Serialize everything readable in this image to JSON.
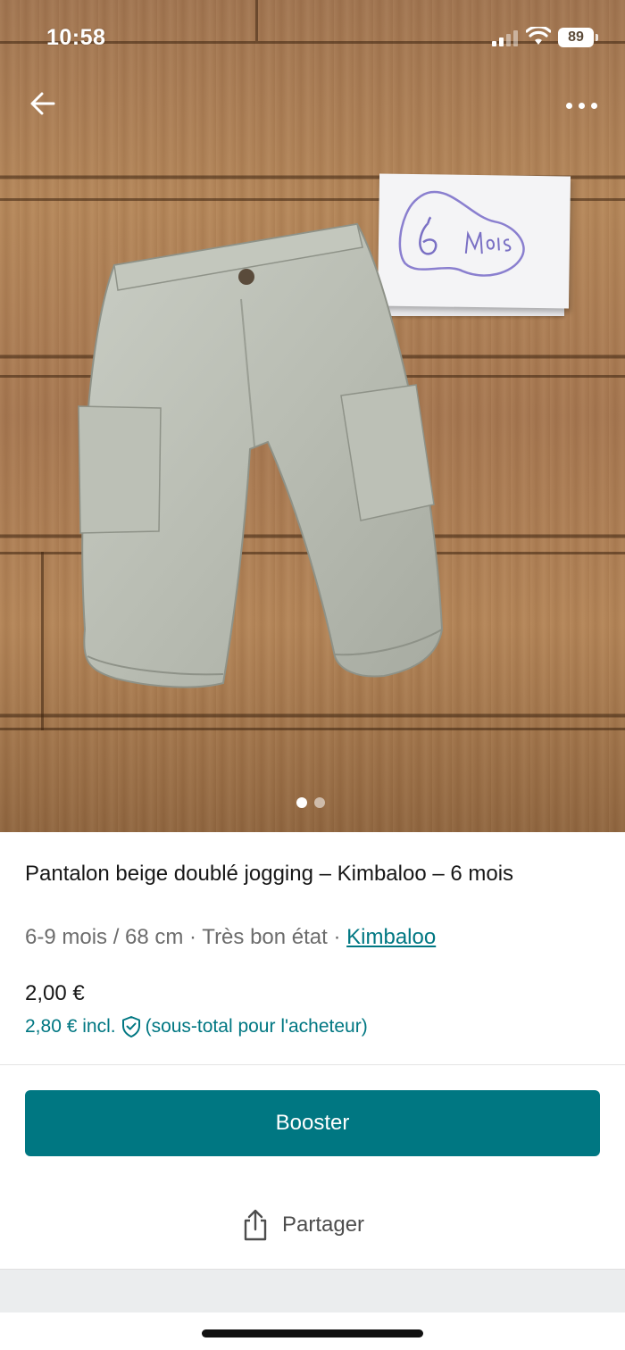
{
  "status_bar": {
    "time": "10:58",
    "battery": "89",
    "icons": [
      "signal-icon",
      "wifi-icon",
      "battery-icon"
    ]
  },
  "photo": {
    "note_text": "6 Mois",
    "carousel": {
      "count": 2,
      "active_index": 0
    },
    "icons": [
      "arrow-left-icon",
      "more-horizontal-icon"
    ]
  },
  "product": {
    "title": "Pantalon beige doublé jogging – Kimbaloo – 6 mois",
    "size": "6-9 mois / 68 cm",
    "separator": " · ",
    "condition": "Très bon état",
    "brand": "Kimbaloo",
    "price": "2,00 €",
    "price_incl": "2,80 € incl.",
    "price_incl_note": "(sous-total pour l'acheteur)"
  },
  "actions": {
    "booster_label": "Booster",
    "share_label": "Partager"
  },
  "colors": {
    "accent": "#007782",
    "text": "#171717",
    "muted": "#6c6c6c"
  }
}
